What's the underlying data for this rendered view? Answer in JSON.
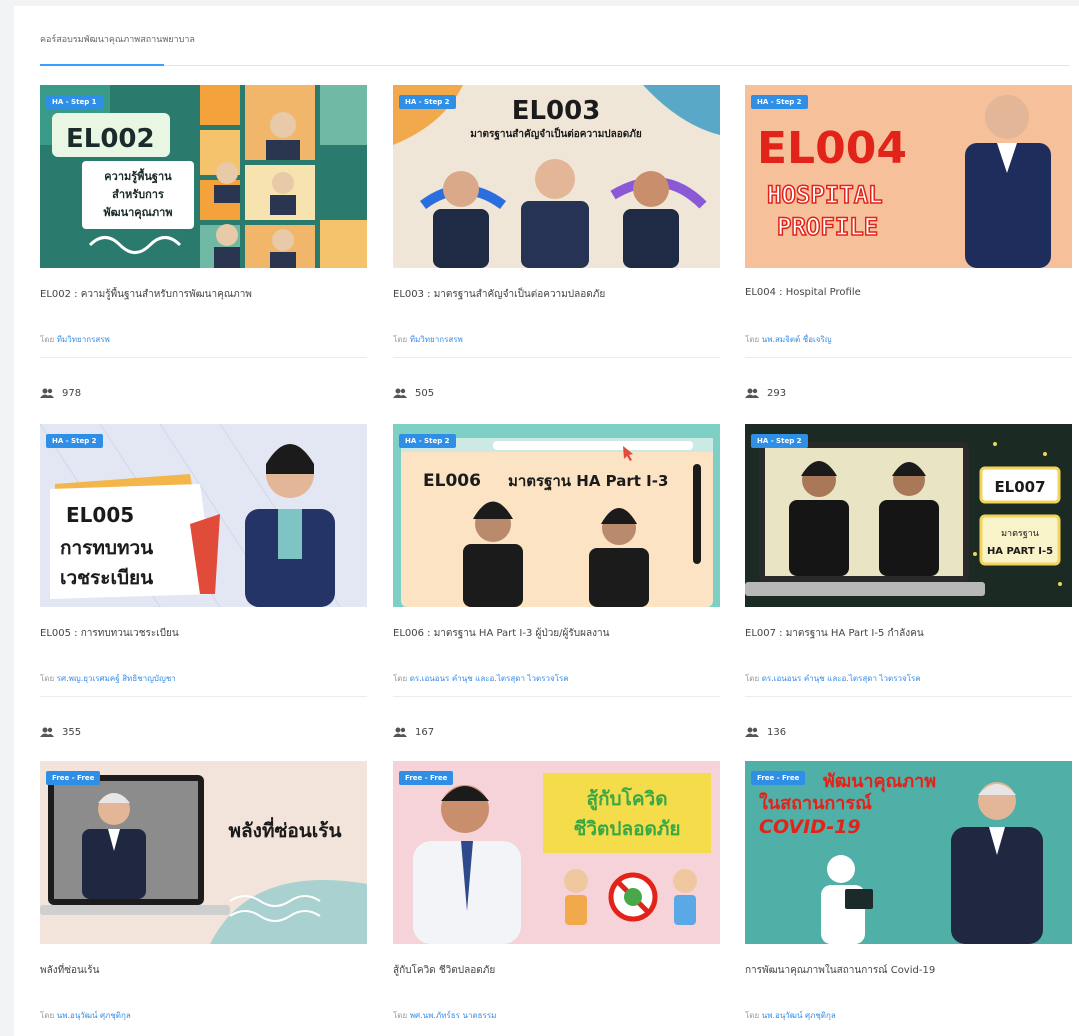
{
  "tab": {
    "label": "คอร์สอบรมพัฒนาคุณภาพสถานพยาบาล"
  },
  "by_prefix": "โดย",
  "courses": [
    {
      "badge": "HA - Step 1",
      "thumb_code": "EL002",
      "thumb_lines": [
        "ความรู้พื้นฐาน",
        "สำหรับการ",
        "พัฒนาคุณภาพ"
      ],
      "title": "EL002 : ความรู้พื้นฐานสำหรับการพัฒนาคุณภาพ",
      "author": "ทีมวิทยากรสรพ",
      "learners": "978"
    },
    {
      "badge": "HA - Step 2",
      "thumb_code": "EL003",
      "thumb_lines": [
        "มาตรฐานสำคัญจำเป็นต่อความปลอดภัย"
      ],
      "title": "EL003 : มาตรฐานสำคัญจำเป็นต่อความปลอดภัย",
      "author": "ทีมวิทยากรสรพ",
      "learners": "505"
    },
    {
      "badge": "HA - Step 2",
      "thumb_code": "EL004",
      "thumb_lines": [
        "HOSPITAL",
        "PROFILE"
      ],
      "title": "EL004 : Hospital Profile",
      "author": "นพ.สมจิตต์ ชื่อเจริญ",
      "learners": "293"
    },
    {
      "badge": "HA - Step 2",
      "thumb_code": "EL005",
      "thumb_lines": [
        "การทบทวน",
        "เวชระเบียน"
      ],
      "title": "EL005 : การทบทวนเวชระเบียน",
      "author": "รศ.พญ.ยุวเรศมคฐ์ สิทธิชาญบัญชา",
      "learners": "355"
    },
    {
      "badge": "HA - Step 2",
      "thumb_code": "EL006",
      "thumb_lines": [
        "มาตรฐาน HA Part I-3"
      ],
      "title": "EL006 : มาตรฐาน HA Part I-3 ผู้ป่วย/ผู้รับผลงาน",
      "author": "ดร.เอนอนร คำนุช และอ.ไตรสุดา ไวตรวจโรค",
      "learners": "167"
    },
    {
      "badge": "HA - Step 2",
      "thumb_code": "EL007",
      "thumb_lines": [
        "มาตรฐาน",
        "HA PART I-5"
      ],
      "title": "EL007 : มาตรฐาน HA Part I-5 กำลังคน",
      "author": "ดร.เอนอนร คำนุช และอ.ไตรสุดา ไวตรวจโรค",
      "learners": "136"
    },
    {
      "badge": "Free - Free",
      "thumb_code": "",
      "thumb_lines": [
        "พลังที่ซ่อนเร้น"
      ],
      "title": "พลังที่ซ่อนเร้น",
      "author": "นพ.อนุวัฒน์ ศุภชุติกุล",
      "learners": ""
    },
    {
      "badge": "Free - Free",
      "thumb_code": "",
      "thumb_lines": [
        "สู้กับโควิด",
        "ชีวิตปลอดภัย"
      ],
      "title": "สู้กับโควิด ชีวิตปลอดภัย",
      "author": "พศ.นพ.ภัทร์ธร นาดธรรม",
      "learners": ""
    },
    {
      "badge": "Free - Free",
      "thumb_code": "",
      "thumb_lines": [
        "พัฒนาคุณภาพ",
        "ในสถานการณ์",
        "COVID-19"
      ],
      "title": "การพัฒนาคุณภาพในสถานการณ์ Covid-19",
      "author": "นพ.อนุวัฒน์ ศุภชุติกุล",
      "learners": ""
    }
  ]
}
